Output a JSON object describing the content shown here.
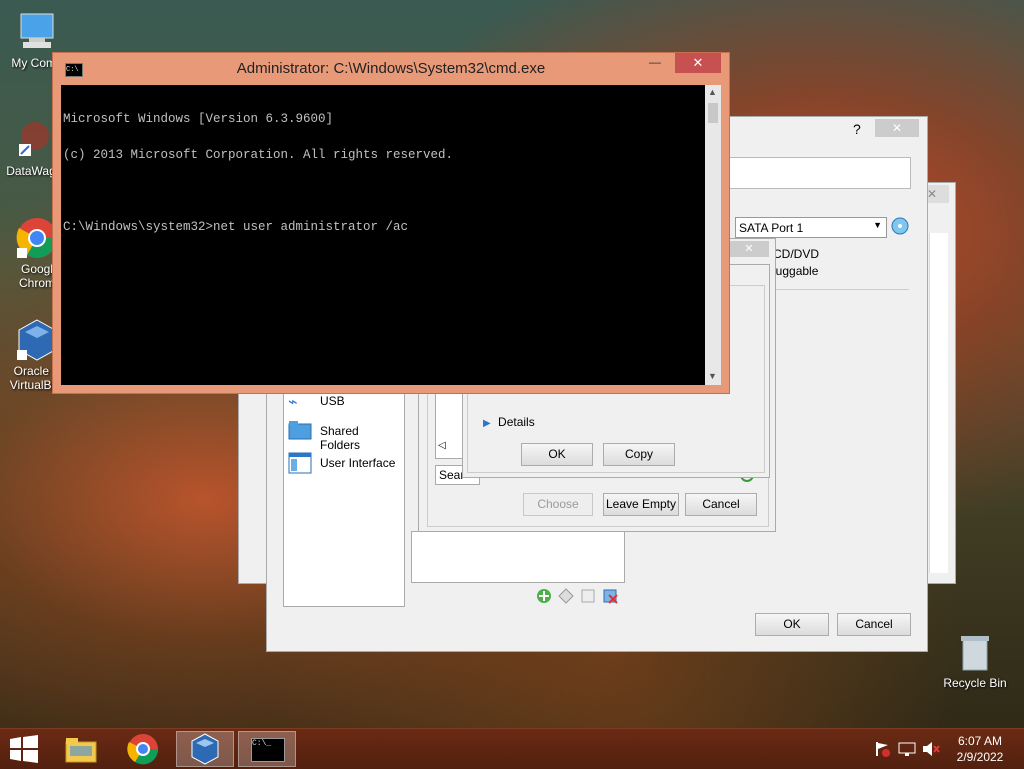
{
  "desktop": {
    "icons": [
      {
        "label": "My Comp"
      },
      {
        "label": "DataWag"
      },
      {
        "label": "Googl Chrom"
      },
      {
        "label": "Oracle V VirtualBox"
      },
      {
        "label": "Recycle Bin"
      }
    ]
  },
  "cmd": {
    "title": "Administrator: C:\\Windows\\System32\\cmd.exe",
    "lines": [
      "Microsoft Windows [Version 6.3.9600]",
      "(c) 2013 Microsoft Corporation. All rights reserved.",
      "",
      "C:\\Windows\\system32>net user administrator /ac"
    ]
  },
  "vbox_settings": {
    "help_glyph": "?",
    "port_select": "SATA Port 1",
    "option_cd": "CD/DVD",
    "option_hot": "luggable",
    "sidebar_items": [
      {
        "label": "USB"
      },
      {
        "label": "Shared Folders"
      },
      {
        "label": "User Interface"
      }
    ],
    "ok_label": "OK",
    "cancel_label": "Cancel"
  },
  "medium_selector": {
    "search_placeholder": "Sear",
    "choose_label": "Choose",
    "leave_empty_label": "Leave Empty",
    "cancel_label": "Cancel"
  },
  "message_box": {
    "details_label": "Details",
    "ok_label": "OK",
    "copy_label": "Copy"
  },
  "taskbar": {
    "time": "6:07 AM",
    "date": "2/9/2022"
  },
  "colors": {
    "cmd_frame": "#e89a78",
    "taskbar": "#5a2210",
    "close_button": "#c75050"
  }
}
